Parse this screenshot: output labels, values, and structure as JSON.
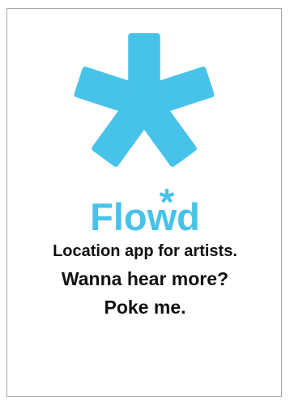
{
  "logo": {
    "brand_name": "Flowd",
    "mark_icon": "asterisk-icon",
    "accent_color": "#47c3ea"
  },
  "tagline": {
    "line1": "Location app for artists.",
    "line2": "Wanna hear more?",
    "line3": "Poke me."
  }
}
